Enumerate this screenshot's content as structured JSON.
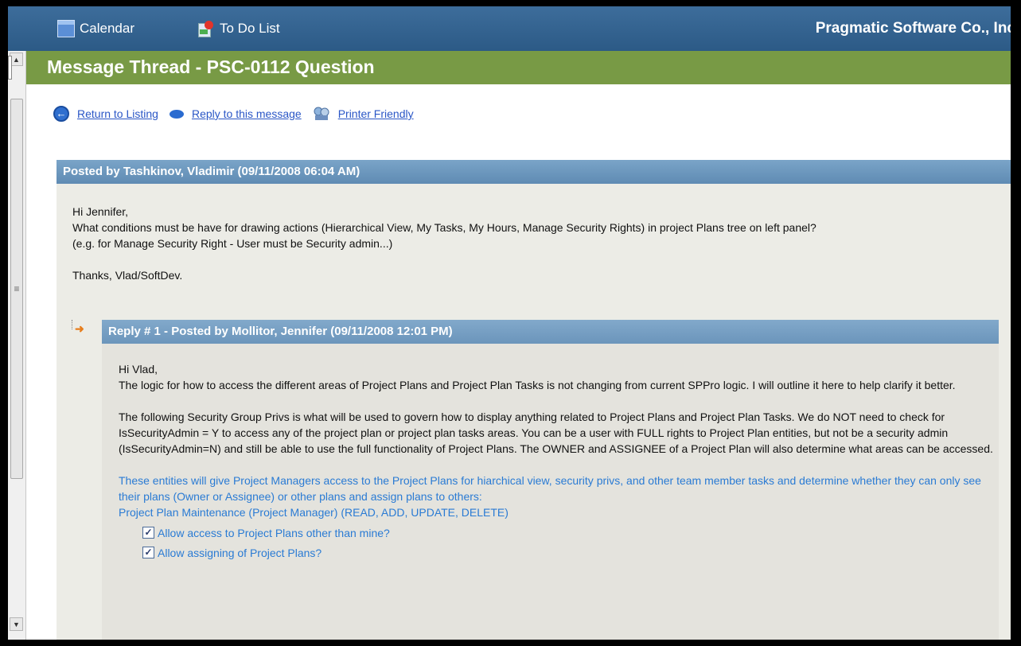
{
  "topbar": {
    "calendar_label": "Calendar",
    "todo_label": "To Do List",
    "company": "Pragmatic Software Co., Inc"
  },
  "page": {
    "title": "Message Thread - PSC-0112 Question"
  },
  "actions": {
    "return_label": "Return to Listing",
    "reply_label": "Reply to this message",
    "print_label": "Printer Friendly"
  },
  "post": {
    "header": "Posted by Tashkinov, Vladimir (09/11/2008 06:04 AM)",
    "greeting": "Hi Jennifer,",
    "line1": "What conditions must be have for drawing actions (Hierarchical View, My Tasks, My Hours, Manage Security Rights) in project Plans tree on left panel?",
    "line2": "(e.g. for Manage Security Right - User must be Security admin...)",
    "signoff": "Thanks, Vlad/SoftDev."
  },
  "reply": {
    "header": "Reply # 1 - Posted by Mollitor, Jennifer (09/11/2008 12:01 PM)",
    "greeting": "Hi Vlad,",
    "para1": "The logic for how to access the different areas of Project Plans and Project Plan Tasks is not changing from current SPPro logic.  I will outline it here to help clarify it better.",
    "para2": "The following Security Group Privs is what will be used to govern how to display anything related to Project Plans and Project Plan Tasks.  We do NOT need to check for IsSecurityAdmin = Y to access any of the project plan or project plan tasks areas.  You can be a user with FULL rights to Project Plan entities, but not be a security admin (IsSecurityAdmin=N) and still be able to use the full functionality of Project Plans.  The OWNER and ASSIGNEE of a Project Plan will also determine what areas can be accessed.",
    "blue_para": "These entities will give Project Managers access to the Project Plans for hiarchical view, security privs, and other team member tasks and determine whether they can only see their plans (Owner or Assignee) or other plans and assign plans to others:",
    "blue_line": "Project Plan Maintenance (Project Manager) (READ, ADD, UPDATE, DELETE)",
    "checkboxes": [
      {
        "label": "Allow access to Project Plans other than mine?",
        "checked": true
      },
      {
        "label": "Allow assigning of Project Plans?",
        "checked": true
      }
    ]
  }
}
